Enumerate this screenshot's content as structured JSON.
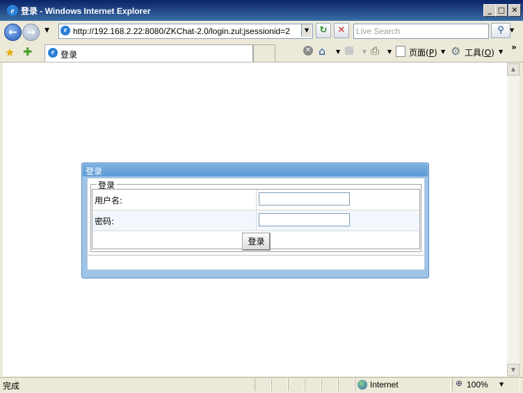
{
  "window": {
    "title": "登录 - Windows Internet Explorer"
  },
  "address": {
    "url": "http://192.168.2.22:8080/ZKChat-2.0/login.zul;jsessionid=2"
  },
  "search": {
    "placeholder": "Live Search"
  },
  "tab": {
    "label": "登录"
  },
  "toolbar": {
    "page_label": "页面",
    "page_key": "P",
    "tools_label": "工具",
    "tools_key": "O"
  },
  "dialog": {
    "title": "登录",
    "legend": "登录",
    "username_label": "用户名:",
    "username_value": "",
    "password_label": "密码:",
    "password_value": "",
    "submit_label": "登录"
  },
  "status": {
    "text": "完成",
    "zone": "Internet",
    "zoom": "100%"
  }
}
